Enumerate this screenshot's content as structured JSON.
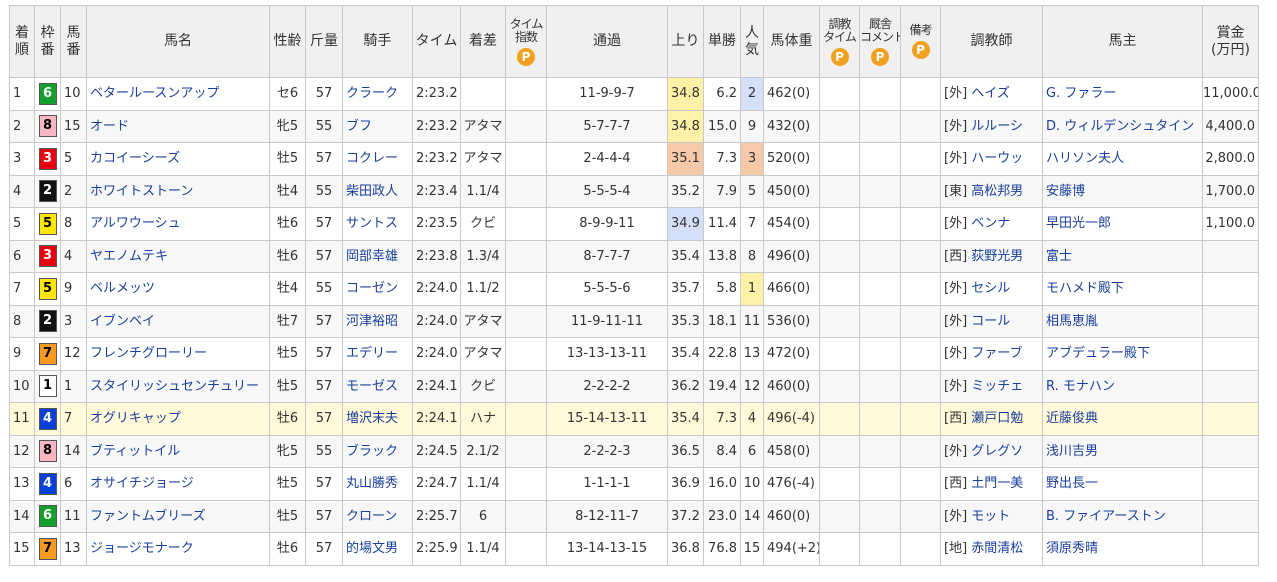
{
  "headers": {
    "finish": [
      "着",
      "順"
    ],
    "frame": [
      "枠",
      "番"
    ],
    "horse_no": [
      "馬",
      "番"
    ],
    "name": "馬名",
    "sex_age": "性齢",
    "weight": "斤量",
    "jockey": "騎手",
    "time": "タイム",
    "margin": "着差",
    "time_index": [
      "タイム",
      "指数"
    ],
    "passing": "通過",
    "last3f": "上り",
    "odds": "単勝",
    "popularity": [
      "人",
      "気"
    ],
    "body_weight": "馬体重",
    "training_time": [
      "調教",
      "タイム"
    ],
    "stable_comment": [
      "厩舎",
      "コメント"
    ],
    "remarks": "備考",
    "trainer": "調教師",
    "owner": "馬主",
    "prize": [
      "賞金",
      "(万円)"
    ],
    "premium_badge": "P"
  },
  "colors": {
    "frame_1": "#ffffff",
    "frame_2": "#111111",
    "frame_3": "#e60012",
    "frame_4": "#0a3fd8",
    "frame_5": "#ffe600",
    "frame_6": "#159e2e",
    "frame_7": "#f79a1f",
    "frame_8": "#f7b6c4",
    "premium": "#f1a020",
    "link": "#1a3f9c"
  },
  "rows": [
    {
      "finish": "1",
      "frame": "6",
      "no": "10",
      "name": "ベタールースンアップ",
      "sex_age": "セ6",
      "weight": "57",
      "jockey": "クラーク",
      "time": "2:23.2",
      "margin": "",
      "passing": "11-9-9-7",
      "last3f": "34.8",
      "last3f_rank": "1",
      "odds": "6.2",
      "pop": "2",
      "body": "462(0)",
      "trainer_region": "[外]",
      "trainer": "ヘイズ",
      "owner": "G. ファラー",
      "prize": "11,000.0"
    },
    {
      "finish": "2",
      "frame": "8",
      "no": "15",
      "name": "オード",
      "sex_age": "牝5",
      "weight": "55",
      "jockey": "ブフ",
      "time": "2:23.2",
      "margin": "アタマ",
      "passing": "5-7-7-7",
      "last3f": "34.8",
      "last3f_rank": "1",
      "odds": "15.0",
      "pop": "9",
      "body": "432(0)",
      "trainer_region": "[外]",
      "trainer": "ルルーシ",
      "owner": "D. ウィルデンシュタイン",
      "prize": "4,400.0"
    },
    {
      "finish": "3",
      "frame": "3",
      "no": "5",
      "name": "カコイーシーズ",
      "sex_age": "牡5",
      "weight": "57",
      "jockey": "コクレー",
      "time": "2:23.2",
      "margin": "アタマ",
      "passing": "2-4-4-4",
      "last3f": "35.1",
      "last3f_rank": "3",
      "odds": "7.3",
      "pop": "3",
      "body": "520(0)",
      "trainer_region": "[外]",
      "trainer": "ハーウッ",
      "owner": "ハリソン夫人",
      "prize": "2,800.0"
    },
    {
      "finish": "4",
      "frame": "2",
      "no": "2",
      "name": "ホワイトストーン",
      "sex_age": "牡4",
      "weight": "55",
      "jockey": "柴田政人",
      "time": "2:23.4",
      "margin": "1.1/4",
      "passing": "5-5-5-4",
      "last3f": "35.2",
      "last3f_rank": "",
      "odds": "7.9",
      "pop": "5",
      "body": "450(0)",
      "trainer_region": "[東]",
      "trainer": "高松邦男",
      "owner": "安藤博",
      "prize": "1,700.0"
    },
    {
      "finish": "5",
      "frame": "5",
      "no": "8",
      "name": "アルワウーシュ",
      "sex_age": "牡6",
      "weight": "57",
      "jockey": "サントス",
      "time": "2:23.5",
      "margin": "クビ",
      "passing": "8-9-9-11",
      "last3f": "34.9",
      "last3f_rank": "2",
      "odds": "11.4",
      "pop": "7",
      "body": "454(0)",
      "trainer_region": "[外]",
      "trainer": "ベンナ",
      "owner": "早田光一郎",
      "prize": "1,100.0"
    },
    {
      "finish": "6",
      "frame": "3",
      "no": "4",
      "name": "ヤエノムテキ",
      "sex_age": "牡6",
      "weight": "57",
      "jockey": "岡部幸雄",
      "time": "2:23.8",
      "margin": "1.3/4",
      "passing": "8-7-7-7",
      "last3f": "35.4",
      "last3f_rank": "",
      "odds": "13.8",
      "pop": "8",
      "body": "496(0)",
      "trainer_region": "[西]",
      "trainer": "荻野光男",
      "owner": "富士",
      "prize": ""
    },
    {
      "finish": "7",
      "frame": "5",
      "no": "9",
      "name": "ベルメッツ",
      "sex_age": "牡4",
      "weight": "55",
      "jockey": "コーゼン",
      "time": "2:24.0",
      "margin": "1.1/2",
      "passing": "5-5-5-6",
      "last3f": "35.7",
      "last3f_rank": "",
      "odds": "5.8",
      "pop": "1",
      "body": "466(0)",
      "trainer_region": "[外]",
      "trainer": "セシル",
      "owner": "モハメド殿下",
      "prize": ""
    },
    {
      "finish": "8",
      "frame": "2",
      "no": "3",
      "name": "イブンベイ",
      "sex_age": "牡7",
      "weight": "57",
      "jockey": "河津裕昭",
      "time": "2:24.0",
      "margin": "アタマ",
      "passing": "11-9-11-11",
      "last3f": "35.3",
      "last3f_rank": "",
      "odds": "18.1",
      "pop": "11",
      "body": "536(0)",
      "trainer_region": "[外]",
      "trainer": "コール",
      "owner": "相馬恵胤",
      "prize": ""
    },
    {
      "finish": "9",
      "frame": "7",
      "no": "12",
      "name": "フレンチグローリー",
      "sex_age": "牡5",
      "weight": "57",
      "jockey": "エデリー",
      "time": "2:24.0",
      "margin": "アタマ",
      "passing": "13-13-13-11",
      "last3f": "35.4",
      "last3f_rank": "",
      "odds": "22.8",
      "pop": "13",
      "body": "472(0)",
      "trainer_region": "[外]",
      "trainer": "ファーブ",
      "owner": "アブデュラー殿下",
      "prize": ""
    },
    {
      "finish": "10",
      "frame": "1",
      "no": "1",
      "name": "スタイリッシュセンチュリー",
      "sex_age": "牡5",
      "weight": "57",
      "jockey": "モーゼス",
      "time": "2:24.1",
      "margin": "クビ",
      "passing": "2-2-2-2",
      "last3f": "36.2",
      "last3f_rank": "",
      "odds": "19.4",
      "pop": "12",
      "body": "460(0)",
      "trainer_region": "[外]",
      "trainer": "ミッチェ",
      "owner": "R. モナハン",
      "prize": ""
    },
    {
      "finish": "11",
      "frame": "4",
      "no": "7",
      "name": "オグリキャップ",
      "sex_age": "牡6",
      "weight": "57",
      "jockey": "増沢末夫",
      "time": "2:24.1",
      "margin": "ハナ",
      "passing": "15-14-13-11",
      "last3f": "35.4",
      "last3f_rank": "",
      "odds": "7.3",
      "pop": "4",
      "body": "496(-4)",
      "trainer_region": "[西]",
      "trainer": "瀬戸口勉",
      "owner": "近藤俊典",
      "prize": "",
      "highlight": true
    },
    {
      "finish": "12",
      "frame": "8",
      "no": "14",
      "name": "ブティットイル",
      "sex_age": "牝5",
      "weight": "55",
      "jockey": "ブラック",
      "time": "2:24.5",
      "margin": "2.1/2",
      "passing": "2-2-2-3",
      "last3f": "36.5",
      "last3f_rank": "",
      "odds": "8.4",
      "pop": "6",
      "body": "458(0)",
      "trainer_region": "[外]",
      "trainer": "グレグソ",
      "owner": "浅川吉男",
      "prize": ""
    },
    {
      "finish": "13",
      "frame": "4",
      "no": "6",
      "name": "オサイチジョージ",
      "sex_age": "牡5",
      "weight": "57",
      "jockey": "丸山勝秀",
      "time": "2:24.7",
      "margin": "1.1/4",
      "passing": "1-1-1-1",
      "last3f": "36.9",
      "last3f_rank": "",
      "odds": "16.0",
      "pop": "10",
      "body": "476(-4)",
      "trainer_region": "[西]",
      "trainer": "土門一美",
      "owner": "野出長一",
      "prize": ""
    },
    {
      "finish": "14",
      "frame": "6",
      "no": "11",
      "name": "ファントムブリーズ",
      "sex_age": "牡5",
      "weight": "57",
      "jockey": "クローン",
      "time": "2:25.7",
      "margin": "6",
      "passing": "8-12-11-7",
      "last3f": "37.2",
      "last3f_rank": "",
      "odds": "23.0",
      "pop": "14",
      "body": "460(0)",
      "trainer_region": "[外]",
      "trainer": "モット",
      "owner": "B. ファイアーストン",
      "prize": ""
    },
    {
      "finish": "15",
      "frame": "7",
      "no": "13",
      "name": "ジョージモナーク",
      "sex_age": "牡6",
      "weight": "57",
      "jockey": "的場文男",
      "time": "2:25.9",
      "margin": "1.1/4",
      "passing": "13-14-13-15",
      "last3f": "36.8",
      "last3f_rank": "",
      "odds": "76.8",
      "pop": "15",
      "body": "494(+2)",
      "trainer_region": "[地]",
      "trainer": "赤間清松",
      "owner": "須原秀晴",
      "prize": ""
    }
  ]
}
